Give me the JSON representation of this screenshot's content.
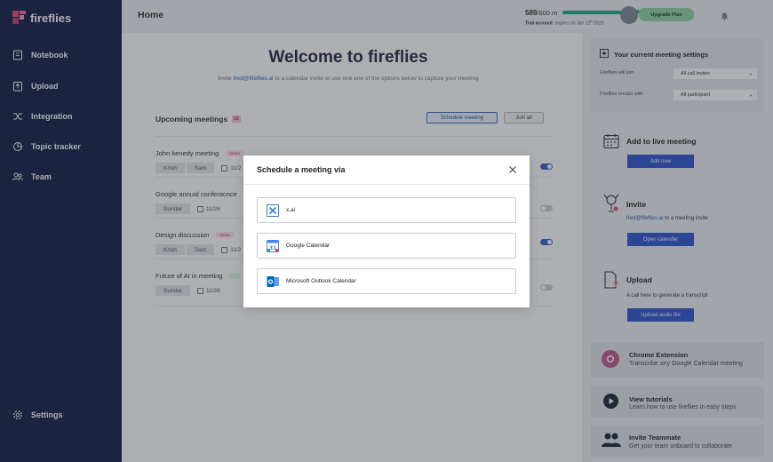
{
  "app": {
    "name": "fireflies"
  },
  "sidebar": {
    "items": [
      {
        "label": "Notebook",
        "icon": "notebook-icon"
      },
      {
        "label": "Upload",
        "icon": "upload-icon"
      },
      {
        "label": "Integration",
        "icon": "integration-icon"
      },
      {
        "label": "Topic tracker",
        "icon": "topic-tracker-icon"
      },
      {
        "label": "Team",
        "icon": "team-icon"
      },
      {
        "label": "Settings",
        "icon": "gear-icon"
      }
    ]
  },
  "header": {
    "title": "Home",
    "minutes_used": "589",
    "minutes_total": "/600 m",
    "minutes_fraction": 0.98,
    "trial_label": "Trial account",
    "trial_expiry": "expires on Jan 12",
    "trial_expiry_sup": "th",
    "trial_year": "2020",
    "upgrade_label": "Upgrade Plan"
  },
  "main": {
    "welcome": "Welcome to fireflies",
    "invite_pre": "Invite ",
    "invite_email": "fred@fifeflies.ai",
    "invite_post": " to a calendar invite or use one one of the options below to capture your meeting",
    "upcoming_title": "Upcoming meetings",
    "upcoming_count": "15",
    "schedule_label": "Schedule meeting",
    "join_all_label": "Join all",
    "meetings": [
      {
        "name": "John kenedy meeting",
        "tag": "DEMO",
        "participants": [
          "Krish",
          "Sam"
        ],
        "date": "11/2",
        "toggle": true
      },
      {
        "name": "Google annual conferacnce",
        "tag": "",
        "participants": [
          "Sundar"
        ],
        "date": "11/26",
        "toggle": false
      },
      {
        "name": "Design discussion",
        "tag": "DEMO",
        "participants": [
          "Krish",
          "Sam"
        ],
        "date": "11/2",
        "toggle": true
      },
      {
        "name": "Future of AI in meeting",
        "tag": "...",
        "participants": [
          "Sundar"
        ],
        "date": "11/26",
        "toggle": false
      }
    ]
  },
  "settings": {
    "title": "Your current meeting settings",
    "join_label": "Fireflies will join",
    "join_value": "All call invites",
    "recap_label": "Fireflies recaps with",
    "recap_value": "All participant"
  },
  "actions": {
    "live": {
      "title": "Add to live meeting",
      "button": "Add now"
    },
    "invite": {
      "title": "Invite",
      "email": "fred@fifeflies.ai",
      "text": " to a meeting invite",
      "button": "Open calender"
    },
    "upload": {
      "title": "Upload",
      "text": "A call here to generate a transcript",
      "button": "Upload audio file"
    }
  },
  "promos": [
    {
      "title": "Chrome Extension",
      "text": "Transcribe any Google Calendar meeting",
      "icon": "chrome-icon"
    },
    {
      "title": "View tutorials",
      "text": "Learn how to use fireflies in easy steps",
      "icon": "play-icon"
    },
    {
      "title": "Invite Teammate",
      "text": "Get your team onboard to collaborate",
      "icon": "people-icon"
    }
  ],
  "modal": {
    "title": "Schedule a meeting via",
    "options": [
      {
        "label": "x.ai",
        "icon": "xai-icon"
      },
      {
        "label": "Google Calendar",
        "icon": "google-calendar-icon"
      },
      {
        "label": "Microsoft Outlook Calendar",
        "icon": "outlook-icon"
      }
    ]
  },
  "colors": {
    "sidebar": "#131d47",
    "accent": "#2f55cf",
    "brand": "#e9467c",
    "success": "#1aaa8a"
  }
}
